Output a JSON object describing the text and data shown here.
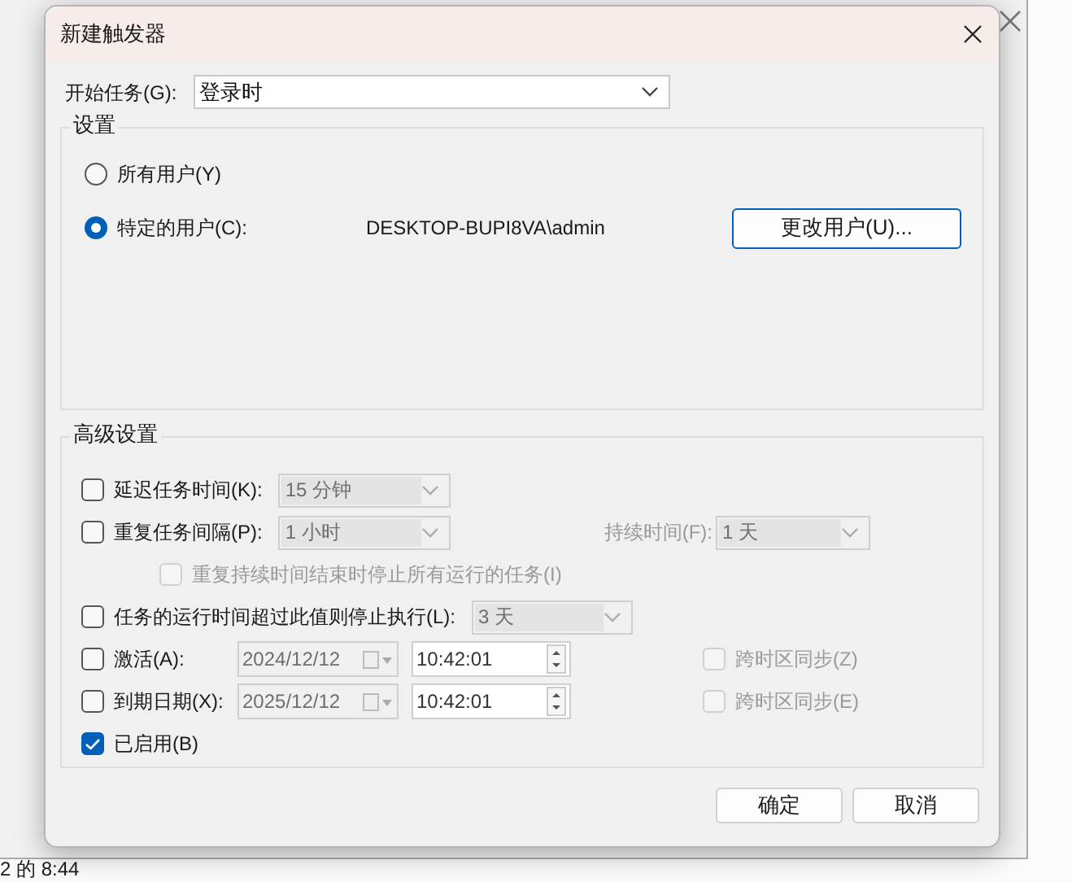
{
  "background_window": {
    "status_text": "2 的 8:44"
  },
  "dialog": {
    "title": "新建触发器",
    "begin_task": {
      "label": "开始任务(G):",
      "value": "登录时"
    },
    "settings": {
      "title": "设置",
      "user": "DESKTOP-BUPI8VA\\admin",
      "change_user_button": "更改用户(U)...",
      "options": [
        {
          "label": "所有用户(Y)",
          "selected": false
        },
        {
          "label": "特定的用户(C):",
          "selected": true
        }
      ]
    },
    "advanced": {
      "title": "高级设置",
      "rows": [
        {
          "kind": "combo",
          "label": "延迟任务时间(K):",
          "checked": false,
          "value": "15 分钟"
        },
        {
          "kind": "combo",
          "label": "重复任务间隔(P):",
          "checked": false,
          "value": "1 小时",
          "extra_label": "持续时间(F):",
          "extra_value": "1 天"
        },
        {
          "kind": "sub",
          "label": "重复持续时间结束时停止所有运行的任务(I)",
          "checked": false,
          "disabled": true
        },
        {
          "kind": "combo",
          "label": "任务的运行时间超过此值则停止执行(L):",
          "checked": false,
          "value": "3 天"
        },
        {
          "kind": "datetime",
          "label": "激活(A):",
          "checked": false,
          "date": "2024/12/12",
          "time": "10:42:01",
          "sync_label": "跨时区同步(Z)",
          "sync_checked": false
        },
        {
          "kind": "datetime",
          "label": "到期日期(X):",
          "checked": false,
          "date": "2025/12/12",
          "time": "10:42:01",
          "sync_label": "跨时区同步(E)",
          "sync_checked": false
        },
        {
          "kind": "check",
          "label": "已启用(B)",
          "checked": true
        }
      ]
    },
    "buttons": [
      {
        "label": "确定"
      },
      {
        "label": "取消"
      }
    ]
  }
}
